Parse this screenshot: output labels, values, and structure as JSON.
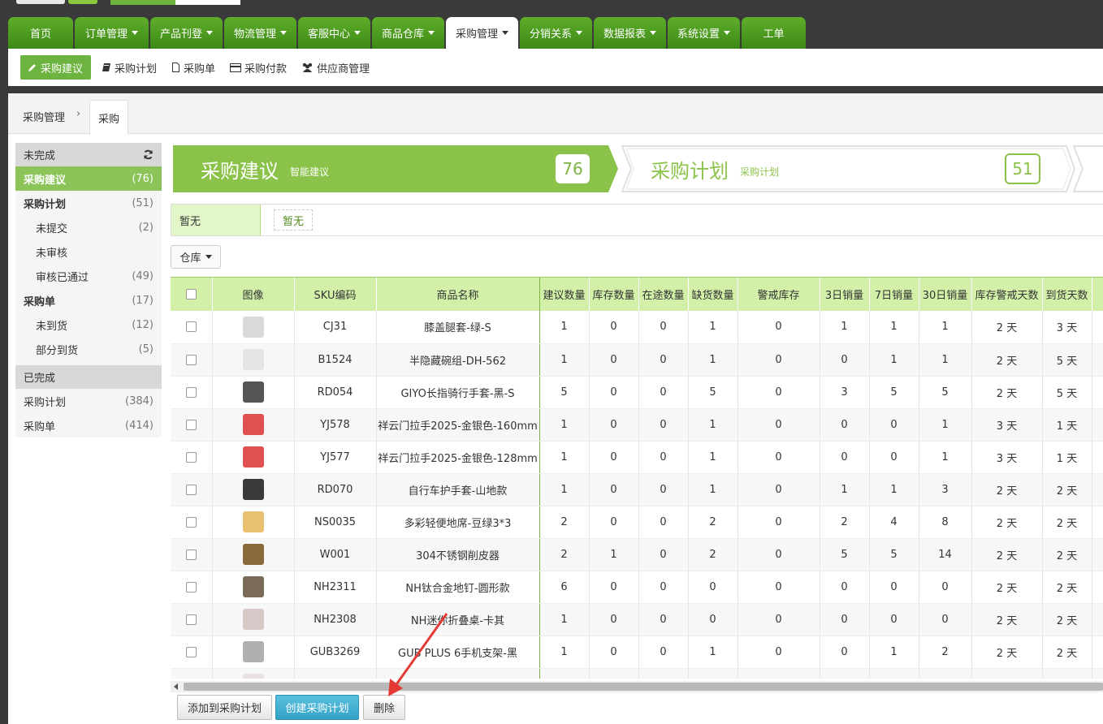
{
  "nav": {
    "tabs": [
      {
        "label": "首页",
        "dropdown": false
      },
      {
        "label": "订单管理",
        "dropdown": true
      },
      {
        "label": "产品刊登",
        "dropdown": true
      },
      {
        "label": "物流管理",
        "dropdown": true
      },
      {
        "label": "客服中心",
        "dropdown": true
      },
      {
        "label": "商品仓库",
        "dropdown": true
      },
      {
        "label": "采购管理",
        "dropdown": true,
        "active": true
      },
      {
        "label": "分销关系",
        "dropdown": true
      },
      {
        "label": "数据报表",
        "dropdown": true
      },
      {
        "label": "系统设置",
        "dropdown": true
      },
      {
        "label": "工单",
        "dropdown": false
      }
    ]
  },
  "subnav": {
    "items": [
      {
        "label": "采购建议",
        "icon": "pencil-icon",
        "active": true
      },
      {
        "label": "采购计划",
        "icon": "book-icon"
      },
      {
        "label": "采购单",
        "icon": "file-icon"
      },
      {
        "label": "采购付款",
        "icon": "credit-card-icon"
      },
      {
        "label": "供应商管理",
        "icon": "users-icon"
      }
    ]
  },
  "breadcrumb": {
    "parent": "采购管理",
    "separator": "›",
    "current": "采购"
  },
  "sidebar": {
    "incomplete_header": "未完成",
    "complete_header": "已完成",
    "items": [
      {
        "label": "采购建议",
        "count": "(76)",
        "style": "active"
      },
      {
        "label": "采购计划",
        "count": "(51)",
        "style": "bold"
      },
      {
        "label": "未提交",
        "count": "(2)",
        "style": "indent"
      },
      {
        "label": "未审核",
        "count": "",
        "style": "indent"
      },
      {
        "label": "审核已通过",
        "count": "(49)",
        "style": "indent"
      },
      {
        "label": "采购单",
        "count": "(17)",
        "style": "bold"
      },
      {
        "label": "未到货",
        "count": "(12)",
        "style": "indent"
      },
      {
        "label": "部分到货",
        "count": "(5)",
        "style": "indent"
      }
    ],
    "completed_items": [
      {
        "label": "采购计划",
        "count": "(384)"
      },
      {
        "label": "采购单",
        "count": "(414)"
      }
    ]
  },
  "steps": [
    {
      "title": "采购建议",
      "subtitle": "智能建议",
      "count": "76"
    },
    {
      "title": "采购计划",
      "subtitle": "采购计划",
      "count": "51"
    }
  ],
  "filter": {
    "label": "暂无",
    "chip": "暂无"
  },
  "warehouse_button": "仓库",
  "table": {
    "headers": [
      "图像",
      "SKU编码",
      "商品名称",
      "建议数量",
      "库存数量",
      "在途数量",
      "缺货数量",
      "警戒库存",
      "3日销量",
      "7日销量",
      "30日销量",
      "库存警戒天数",
      "到货天数"
    ],
    "rows": [
      {
        "sku": "CJ31",
        "name": "膝盖腿套-绿-S",
        "suggest": "1",
        "stock": "0",
        "transit": "0",
        "short": "1",
        "alert": "0",
        "s3": "1",
        "s7": "1",
        "s30": "1",
        "alert_days": "2 天",
        "arrive_days": "3 天",
        "thumb_color": "#d9d9d9"
      },
      {
        "sku": "B1524",
        "name": "半隐藏碗组-DH-562",
        "suggest": "1",
        "stock": "0",
        "transit": "0",
        "short": "1",
        "alert": "0",
        "s3": "0",
        "s7": "1",
        "s30": "1",
        "alert_days": "2 天",
        "arrive_days": "5 天",
        "thumb_color": "#e4e4e4"
      },
      {
        "sku": "RD054",
        "name": "GIYO长指骑行手套-黑-S",
        "suggest": "5",
        "stock": "0",
        "transit": "0",
        "short": "5",
        "alert": "0",
        "s3": "3",
        "s7": "5",
        "s30": "5",
        "alert_days": "2 天",
        "arrive_days": "5 天",
        "thumb_color": "#555555"
      },
      {
        "sku": "YJ578",
        "name": "祥云门拉手2025-金银色-160mm",
        "suggest": "1",
        "stock": "0",
        "transit": "0",
        "short": "1",
        "alert": "0",
        "s3": "0",
        "s7": "0",
        "s30": "1",
        "alert_days": "3 天",
        "arrive_days": "1 天",
        "thumb_color": "#e05050"
      },
      {
        "sku": "YJ577",
        "name": "祥云门拉手2025-金银色-128mm",
        "suggest": "1",
        "stock": "0",
        "transit": "0",
        "short": "1",
        "alert": "0",
        "s3": "0",
        "s7": "0",
        "s30": "1",
        "alert_days": "3 天",
        "arrive_days": "1 天",
        "thumb_color": "#e05050"
      },
      {
        "sku": "RD070",
        "name": "自行车护手套-山地款",
        "suggest": "1",
        "stock": "0",
        "transit": "0",
        "short": "1",
        "alert": "0",
        "s3": "1",
        "s7": "1",
        "s30": "3",
        "alert_days": "2 天",
        "arrive_days": "2 天",
        "thumb_color": "#3a3a3a"
      },
      {
        "sku": "NS0035",
        "name": "多彩轻便地席-豆绿3*3",
        "suggest": "2",
        "stock": "0",
        "transit": "0",
        "short": "2",
        "alert": "0",
        "s3": "2",
        "s7": "4",
        "s30": "8",
        "alert_days": "2 天",
        "arrive_days": "2 天",
        "thumb_color": "#e8c070"
      },
      {
        "sku": "W001",
        "name": "304不锈钢削皮器",
        "suggest": "2",
        "stock": "1",
        "transit": "0",
        "short": "2",
        "alert": "0",
        "s3": "5",
        "s7": "5",
        "s30": "14",
        "alert_days": "2 天",
        "arrive_days": "2 天",
        "thumb_color": "#8a6a3a"
      },
      {
        "sku": "NH2311",
        "name": "NH钛合金地钉-圆形款",
        "suggest": "6",
        "stock": "0",
        "transit": "0",
        "short": "0",
        "alert": "0",
        "s3": "0",
        "s7": "0",
        "s30": "0",
        "alert_days": "2 天",
        "arrive_days": "2 天",
        "thumb_color": "#7a6a5a"
      },
      {
        "sku": "NH2308",
        "name": "NH迷你折叠桌-卡其",
        "suggest": "1",
        "stock": "0",
        "transit": "0",
        "short": "0",
        "alert": "0",
        "s3": "0",
        "s7": "0",
        "s30": "0",
        "alert_days": "2 天",
        "arrive_days": "2 天",
        "thumb_color": "#d8c8c8"
      },
      {
        "sku": "GUB3269",
        "name": "GUB PLUS 6手机支架-黑",
        "suggest": "1",
        "stock": "0",
        "transit": "0",
        "short": "1",
        "alert": "0",
        "s3": "0",
        "s7": "1",
        "s30": "2",
        "alert_days": "2 天",
        "arrive_days": "2 天",
        "thumb_color": "#b0b0b0"
      },
      {
        "sku": "",
        "name": "",
        "suggest": "",
        "stock": "",
        "transit": "",
        "short": "",
        "alert": "",
        "s3": "",
        "s7": "",
        "s30": "",
        "alert_days": "",
        "arrive_days": "",
        "thumb_color": "#e8e0e0"
      }
    ]
  },
  "actions": {
    "add_to_plan": "添加到采购计划",
    "create_plan": "创建采购计划",
    "delete": "删除"
  },
  "colors": {
    "nav_green": "#4c9a1f",
    "accent_green": "#8bc34a",
    "primary_blue": "#31a3c7",
    "arrow_red": "#e53935"
  }
}
